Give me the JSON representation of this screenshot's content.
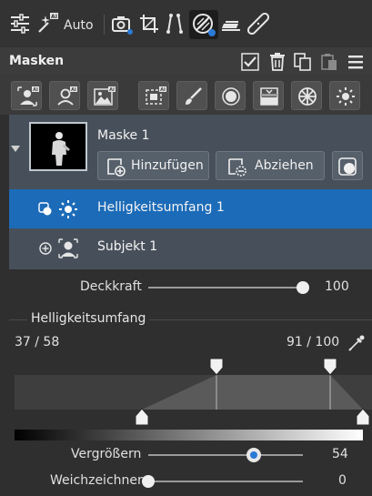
{
  "toolbar": {
    "auto_label": "Auto",
    "ai_badge": "AI",
    "active_tool": "masking-icon",
    "accent": "#2a7ad6"
  },
  "panel": {
    "title": "Masken"
  },
  "mask_types": {
    "ai_badge": "AI"
  },
  "mask": {
    "name": "Maske 1",
    "add_label": "Hinzufügen",
    "subtract_label": "Abziehen",
    "components": [
      {
        "label": "Helligkeitsumfang 1",
        "selected": true
      },
      {
        "label": "Subjekt 1",
        "selected": false
      }
    ]
  },
  "opacity": {
    "label": "Deckkraft",
    "value": "100",
    "level": 100
  },
  "luminance": {
    "title": "Helligkeitsumfang",
    "range_low": "37 / 58",
    "range_high": "91 / 100"
  },
  "expand": {
    "label": "Vergrößern",
    "value": "54",
    "level": 54
  },
  "feather": {
    "label": "Weichzeichnen",
    "value": "0",
    "level": 0
  }
}
